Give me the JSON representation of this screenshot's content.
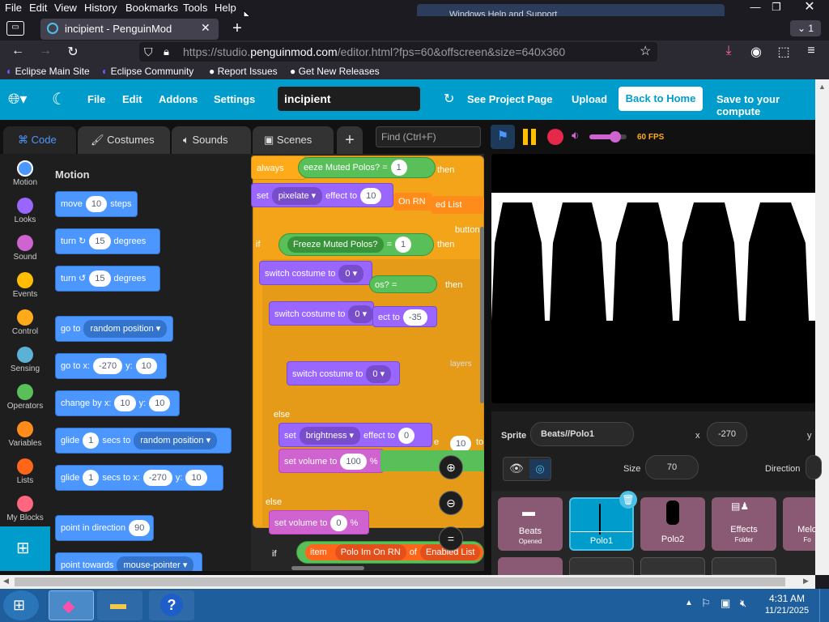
{
  "browser": {
    "menu": [
      "File",
      "Edit",
      "View",
      "History",
      "Bookmarks",
      "Tools",
      "Help"
    ],
    "tab_title": "incipient - PenguinMod",
    "tab_count": "1",
    "url_prefix": "https://studio.",
    "url_domain": "penguinmod.com",
    "url_path": "/editor.html?fps=60&offscreen&size=640x360",
    "bookmarks": [
      "Eclipse Main Site",
      "Eclipse Community",
      "Report Issues",
      "Get New Releases"
    ],
    "bg_window_title": "Windows Help and Support"
  },
  "editor": {
    "menu": {
      "file": "File",
      "edit": "Edit",
      "addons": "Addons",
      "settings": "Settings",
      "project_title": "incipient",
      "see_project_page": "See Project Page",
      "upload": "Upload",
      "back_to_home": "Back to Home",
      "save_to_computer": "Save to your compute"
    },
    "tabs": {
      "code": "Code",
      "costumes": "Costumes",
      "sounds": "Sounds",
      "scenes": "Scenes"
    },
    "find_placeholder": "Find (Ctrl+F)",
    "categories": [
      {
        "label": "Motion",
        "color": "#4c97ff"
      },
      {
        "label": "Looks",
        "color": "#9966ff"
      },
      {
        "label": "Sound",
        "color": "#cf63cf"
      },
      {
        "label": "Events",
        "color": "#ffbf00"
      },
      {
        "label": "Control",
        "color": "#ffab19"
      },
      {
        "label": "Sensing",
        "color": "#5cb1d6"
      },
      {
        "label": "Operators",
        "color": "#59c059"
      },
      {
        "label": "Variables",
        "color": "#ff8c1a"
      },
      {
        "label": "Lists",
        "color": "#ff661a"
      },
      {
        "label": "My Blocks",
        "color": "#ff6680"
      }
    ],
    "palette": {
      "heading": "Motion",
      "move": {
        "pre": "move",
        "value": "10",
        "post": "steps"
      },
      "turn_right": {
        "pre": "turn",
        "value": "15",
        "post": "degrees"
      },
      "turn_left": {
        "pre": "turn",
        "value": "15",
        "post": "degrees"
      },
      "go_to": {
        "pre": "go to",
        "menu": "random position"
      },
      "go_to_xy": {
        "pre": "go to x:",
        "x": "-270",
        "mid": "y:",
        "y": "10"
      },
      "change_by": {
        "pre": "change by x:",
        "x": "10",
        "mid": "y:",
        "y": "10"
      },
      "glide_to": {
        "pre": "glide",
        "value": "1",
        "mid": "secs to",
        "menu": "random position"
      },
      "glide_xy": {
        "pre": "glide",
        "value": "1",
        "mid": "secs to x:",
        "x": "-270",
        "mid2": "y:",
        "y": "10"
      },
      "point_direction": {
        "pre": "point in direction",
        "value": "90"
      },
      "point_towards": {
        "pre": "point towards",
        "menu": "mouse-pointer"
      }
    },
    "script": {
      "always": "always",
      "freeze_top": "eeze Muted Polos?",
      "eq": "=",
      "one": "1",
      "then": "then",
      "set": "set",
      "pixelate": "pixelate",
      "effect_to": "effect to",
      "ten": "10",
      "on_rn": "On RN",
      "ed_list": "ed List",
      "button": "button",
      "if": "if",
      "freeze_mid": "Freeze Muted Polos?",
      "switch_costume_to": "switch costume to",
      "zero": "0",
      "os": "os?",
      "then2": "then",
      "ect_to": "ect to",
      "minus35": "-35",
      "layers": "layers",
      "else": "else",
      "brightness": "brightness",
      "set_volume_to": "set volume to",
      "hundred": "100",
      "percent": "%",
      "e_to": "e",
      "ten2": "10",
      "to": "to",
      "item": "item",
      "polo_on_rn": "Polo Im On RN",
      "of": "of",
      "enabled_list": "Enabled List"
    },
    "stage": {
      "fps": "60 FPS",
      "volume": 0.7
    },
    "sprite_info": {
      "sprite_label": "Sprite",
      "sprite_name": "Beats//Polo1",
      "x_label": "x",
      "x_value": "-270",
      "y_label": "y",
      "size_label": "Size",
      "size_value": "70",
      "direction_label": "Direction"
    },
    "sprites": [
      {
        "name": "Beats",
        "sub": "Opened"
      },
      {
        "name": "Polo1",
        "sub": ""
      },
      {
        "name": "Polo2",
        "sub": ""
      },
      {
        "name": "Effects",
        "sub": "Folder"
      },
      {
        "name": "Melo",
        "sub": "Fo"
      }
    ]
  },
  "taskbar": {
    "time": "4:31 AM",
    "date": "11/21/2025"
  }
}
